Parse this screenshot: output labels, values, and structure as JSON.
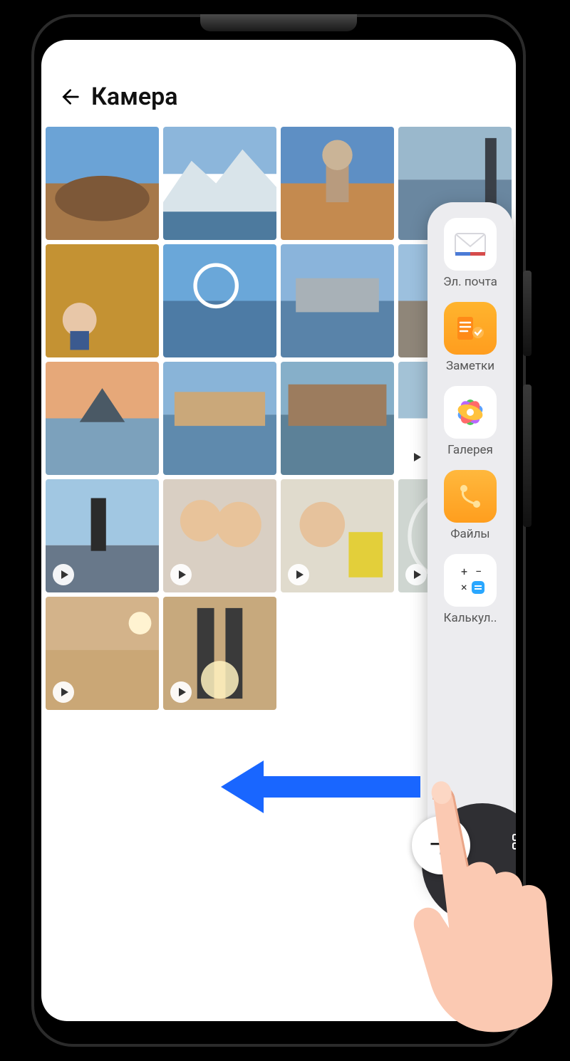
{
  "header": {
    "title": "Камера"
  },
  "thumbs": [
    {
      "video": false
    },
    {
      "video": false
    },
    {
      "video": false
    },
    {
      "video": false
    },
    {
      "video": false
    },
    {
      "video": false
    },
    {
      "video": false
    },
    {
      "video": false
    },
    {
      "video": false
    },
    {
      "video": false
    },
    {
      "video": false
    },
    {
      "video": true
    },
    {
      "video": true
    },
    {
      "video": true
    },
    {
      "video": true
    },
    {
      "video": true
    },
    {
      "video": true
    },
    {
      "video": true
    }
  ],
  "dock": {
    "items": [
      {
        "id": "email",
        "label": "Эл. почта"
      },
      {
        "id": "notes",
        "label": "Заметки"
      },
      {
        "id": "gallery",
        "label": "Галерея"
      },
      {
        "id": "files",
        "label": "Файлы"
      },
      {
        "id": "calculator",
        "label": "Калькул.."
      }
    ]
  }
}
